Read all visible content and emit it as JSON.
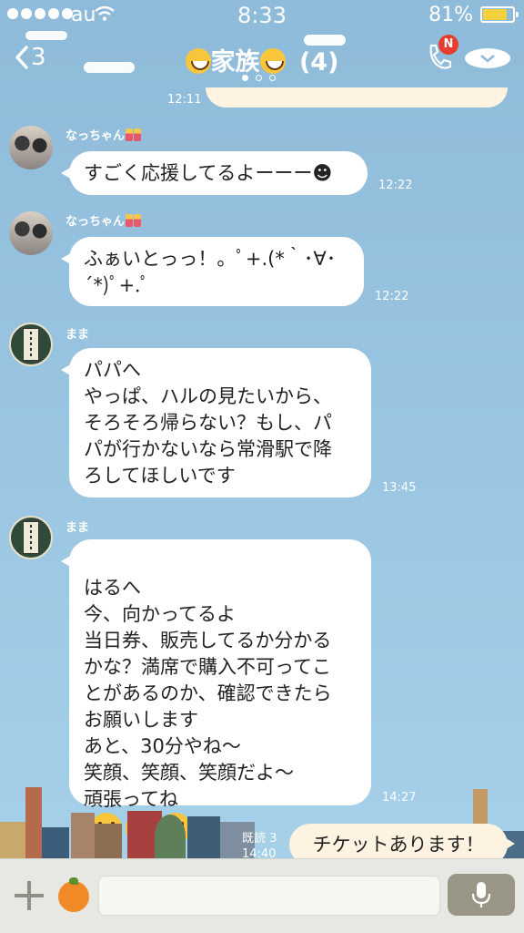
{
  "status_bar": {
    "carrier": "au",
    "time": "8:33",
    "battery": "81%",
    "battery_level": 0.81
  },
  "header": {
    "back_count": "3",
    "title": "家族",
    "member_count": "(4)",
    "notification_badge": "N"
  },
  "partial_message": {
    "time": "12:11"
  },
  "messages": [
    {
      "sender": "なっちゃん",
      "avatar": "girls-photo",
      "text": "すごく応援してるよーーー☻",
      "time": "12:22"
    },
    {
      "sender": "なっちゃん",
      "avatar": "girls-photo",
      "text": "ふぁいとっっ！。ﾟ+.(*｀･∀･´*)ﾟ+.ﾟ",
      "time": "12:22"
    },
    {
      "sender": "まま",
      "avatar": "scroll-image",
      "text": "パパへ\nやっぱ、ハルの見たいから、\nそろそろ帰らない？もし、パ\nパが行かないなら常滑駅で降\nろしてほしいです",
      "time": "13:45"
    },
    {
      "sender": "まま",
      "avatar": "scroll-image",
      "text": "はるへ\n今、向かってるよ\n当日券、販売してるか分かる\nかな？満席で購入不可ってこ\nとがあるのか、確認できたら\nお願いします\nあと、30分やね〜\n笑顔、笑顔、笑顔だよ〜\n頑張ってね",
      "emoji": [
        "tongue-face-emoji",
        "tongue-face-emoji",
        "tongue-face-emoji"
      ],
      "time": "14:27"
    }
  ],
  "my_message": {
    "text": "チケットあります！",
    "read": "既読 3",
    "time": "14:40"
  },
  "input_bar": {
    "placeholder": ""
  },
  "colors": {
    "background": "#9ac6e2",
    "bubble_other": "#ffffff",
    "bubble_mine": "#fdf3e0",
    "badge": "#e83c2e"
  }
}
